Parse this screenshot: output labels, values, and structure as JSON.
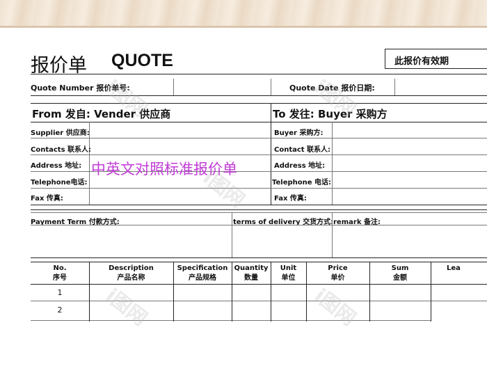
{
  "header": {
    "title_cn": "报价单",
    "title_en": "QUOTE",
    "validity": "此报价有效期"
  },
  "quote_row": {
    "number_label": "Quote Number 报价单号:",
    "date_label": "Quote Date  报价日期:"
  },
  "from": {
    "title": "From 发自: Vender 供应商",
    "fields": [
      "Supplier 供应商:",
      "Contacts 联系人:",
      "Address 地址:",
      "Telephone电话:",
      "Fax 传真:"
    ]
  },
  "to": {
    "title": "To 发往:  Buyer 采购方",
    "fields": [
      "Buyer 采购方:",
      "Contact 联系人:",
      "Address 地址:",
      "Telephone 电话:",
      "Fax 传真:"
    ]
  },
  "overlay_text": "中英文对照标准报价单",
  "terms": {
    "payment": "Payment Term 付款方式:",
    "delivery": "terms of delivery 交货方式:",
    "remark": "remark 备注:"
  },
  "columns": [
    {
      "en": "No.",
      "cn": "序号"
    },
    {
      "en": "Description",
      "cn": "产品名称"
    },
    {
      "en": "Specification",
      "cn": "产品规格"
    },
    {
      "en": "Quantity",
      "cn": "数量"
    },
    {
      "en": "Unit",
      "cn": "单位"
    },
    {
      "en": "Price",
      "cn": "单价"
    },
    {
      "en": "Sum",
      "cn": "金额"
    },
    {
      "en": "Lea",
      "cn": ""
    }
  ],
  "rows": [
    "1",
    "2"
  ],
  "watermark": "i图网",
  "colors": {
    "overlay_text": "#c13bd6",
    "wood": "#efe2d1"
  }
}
